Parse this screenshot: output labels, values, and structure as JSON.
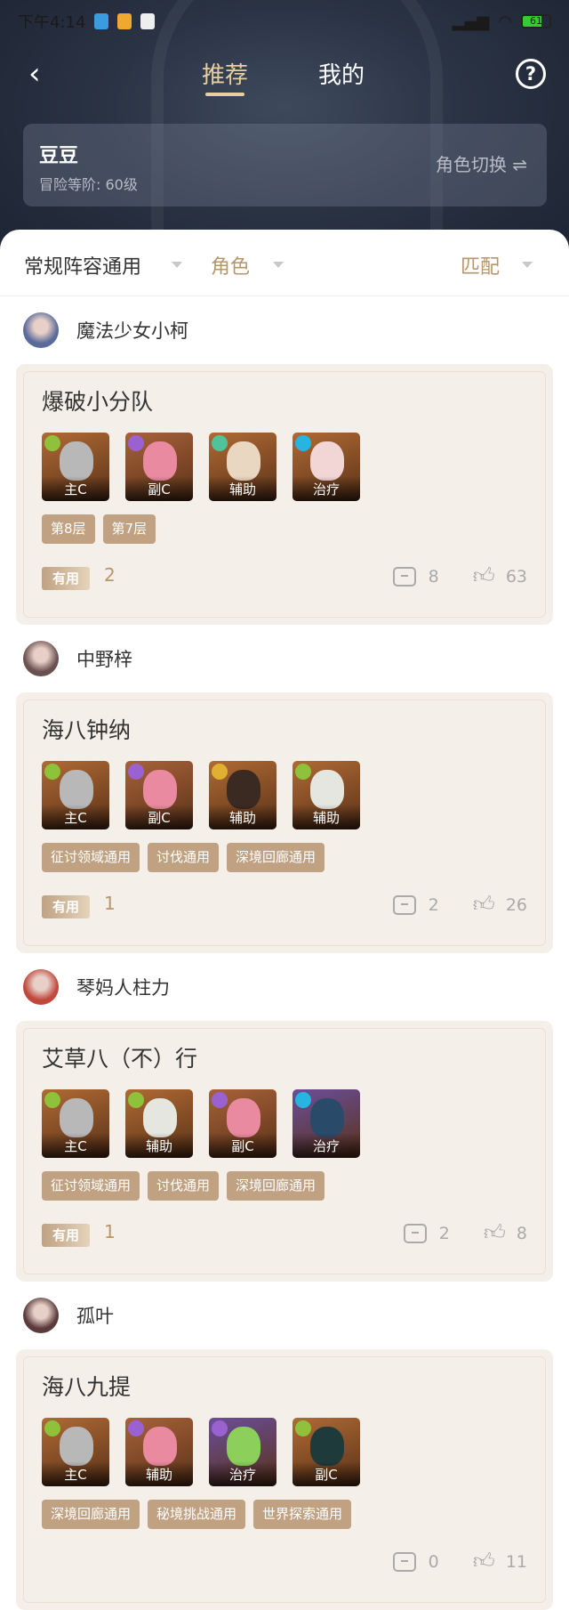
{
  "status_bar": {
    "time": "下午4:14",
    "battery": "61"
  },
  "header": {
    "tabs": [
      {
        "label": "推荐",
        "active": true
      },
      {
        "label": "我的",
        "active": false
      }
    ]
  },
  "user_card": {
    "name": "豆豆",
    "level": "冒险等阶: 60级",
    "switch_label": "角色切换 ⇌"
  },
  "filters": [
    {
      "label": "常规阵容通用",
      "color": "#333333"
    },
    {
      "label": "角色",
      "color": "#b8956b"
    },
    {
      "label": "匹配",
      "color": "#b8956b"
    }
  ],
  "posts": [
    {
      "author": "魔法少女小柯",
      "avatar_color": "#5a6a9a",
      "title": "爆破小分队",
      "roles": [
        {
          "label": "主C",
          "bg": "#b06a34",
          "face": "#b8b8b8",
          "el": "#8fc23a"
        },
        {
          "label": "副C",
          "bg": "#a8623a",
          "face": "#e98aa0",
          "el": "#9a62d0"
        },
        {
          "label": "辅助",
          "bg": "#b06a34",
          "face": "#ead7c2",
          "el": "#4fc49a"
        },
        {
          "label": "治疗",
          "bg": "#b06a34",
          "face": "#f2d6d6",
          "el": "#28b4e0"
        }
      ],
      "tags": [
        "第8层",
        "第7层"
      ],
      "useful": "有用",
      "useful_count": "2",
      "comments": "8",
      "likes": "63"
    },
    {
      "author": "中野梓",
      "avatar_color": "#6b5050",
      "title": "海八钟纳",
      "roles": [
        {
          "label": "主C",
          "bg": "#b06a34",
          "face": "#b8b8b8",
          "el": "#8fc23a"
        },
        {
          "label": "副C",
          "bg": "#a8623a",
          "face": "#e98aa0",
          "el": "#9a62d0"
        },
        {
          "label": "辅助",
          "bg": "#b06a34",
          "face": "#3a2a22",
          "el": "#e0b030"
        },
        {
          "label": "辅助",
          "bg": "#b06a34",
          "face": "#e6e6e0",
          "el": "#8fc23a"
        }
      ],
      "tags": [
        "征讨领域通用",
        "讨伐通用",
        "深境回廊通用"
      ],
      "useful": "有用",
      "useful_count": "1",
      "comments": "2",
      "likes": "26"
    },
    {
      "author": "琴妈人柱力",
      "avatar_color": "#c0473a",
      "title": "艾草八（不）行",
      "roles": [
        {
          "label": "主C",
          "bg": "#b06a34",
          "face": "#b8b8b8",
          "el": "#8fc23a"
        },
        {
          "label": "辅助",
          "bg": "#b06a34",
          "face": "#e6e6e0",
          "el": "#8fc23a"
        },
        {
          "label": "副C",
          "bg": "#a8623a",
          "face": "#e98aa0",
          "el": "#9a62d0"
        },
        {
          "label": "治疗",
          "bg": "#6a4e9a",
          "face": "#2a4a6a",
          "el": "#28b4e0"
        }
      ],
      "tags": [
        "征讨领域通用",
        "讨伐通用",
        "深境回廊通用"
      ],
      "useful": "有用",
      "useful_count": "1",
      "comments": "2",
      "likes": "8"
    },
    {
      "author": "孤叶",
      "avatar_color": "#5a3a3a",
      "title": "海八九提",
      "roles": [
        {
          "label": "主C",
          "bg": "#b06a34",
          "face": "#b8b8b8",
          "el": "#8fc23a"
        },
        {
          "label": "辅助",
          "bg": "#a8623a",
          "face": "#e98aa0",
          "el": "#9a62d0"
        },
        {
          "label": "治疗",
          "bg": "#6a4e9a",
          "face": "#8ccf5a",
          "el": "#9a62d0"
        },
        {
          "label": "副C",
          "bg": "#b06a34",
          "face": "#1f3a3a",
          "el": "#8fc23a"
        }
      ],
      "tags": [
        "深境回廊通用",
        "秘境挑战通用",
        "世界探索通用"
      ],
      "useful": "",
      "useful_count": "",
      "comments": "0",
      "likes": "11"
    }
  ]
}
